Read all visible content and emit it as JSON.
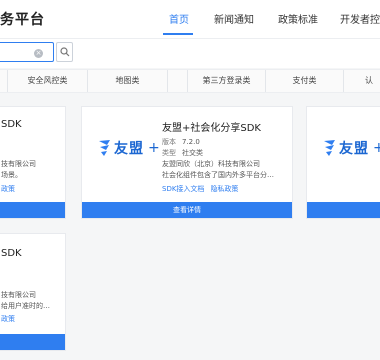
{
  "header": {
    "brand": "务平台",
    "nav": [
      "首页",
      "新闻通知",
      "政策标准",
      "开发者控帖"
    ]
  },
  "search": {
    "clear_glyph": "×"
  },
  "categories": [
    "类",
    "安全风控类",
    "地图类",
    "",
    "第三方登录类",
    "支付类",
    "认"
  ],
  "cards": {
    "left_top": {
      "title": "SDK",
      "line1": "技有限公司",
      "line2": "场景。",
      "link": "政策",
      "button": ""
    },
    "center": {
      "logo_text": "友盟",
      "logo_plus": "+",
      "title": "友盟+社会化分享SDK",
      "version_label": "版本",
      "version": "7.2.0",
      "type_label": "类型",
      "type": "社交类",
      "company": "友盟同欣（北京）科技有限公司",
      "desc": "社会化组件包含了国内外多平台分…",
      "link1": "SDK接入文档",
      "link2": "隐私政策",
      "button": "查看详情"
    },
    "right": {
      "logo_text": "友盟",
      "logo_plus": "+"
    },
    "left_bottom": {
      "title": "SDK",
      "line1": "技有限公司",
      "line2": "给用户准时的…",
      "link": "政策",
      "button": ""
    }
  },
  "colors": {
    "accent": "#2f7ef0",
    "logo": "#1c67d2"
  }
}
